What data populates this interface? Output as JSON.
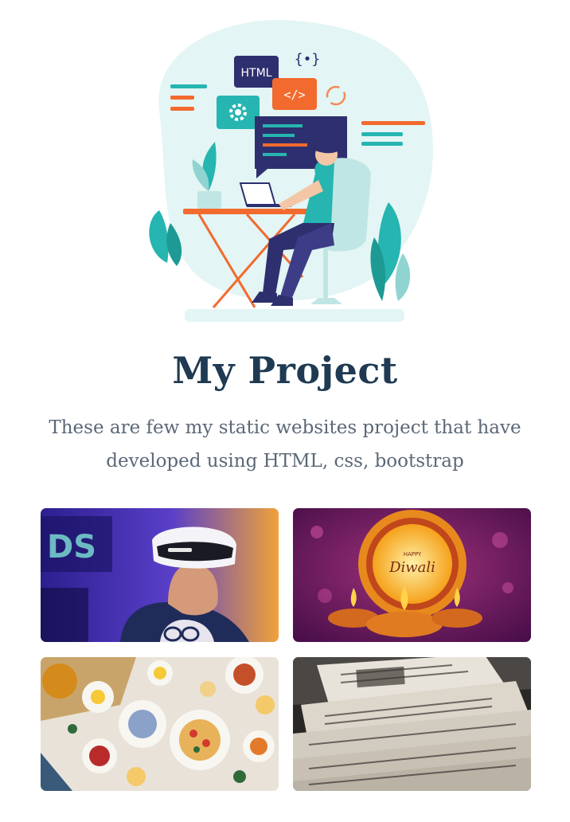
{
  "hero": {
    "code_tag_label": "HTML",
    "code_icon_label": "</>",
    "brace_icon_label": "{•}"
  },
  "heading": {
    "title": "My Project"
  },
  "intro": {
    "line1": "These are few my static websites project that have",
    "line2": "developed using HTML, css, bootstrap"
  },
  "projects": [
    {
      "name": "project-vr-headset",
      "caption": ""
    },
    {
      "name": "project-diwali",
      "caption_line1": "HAPPY",
      "caption_line2": "Diwali"
    },
    {
      "name": "project-food-table",
      "caption": ""
    },
    {
      "name": "project-newspaper",
      "caption": ""
    }
  ],
  "colors": {
    "title": "#1f3a52",
    "subtitle": "#5b6877",
    "teal": "#26b5b0",
    "orange": "#f26a2e",
    "navy": "#2e2f6e"
  }
}
